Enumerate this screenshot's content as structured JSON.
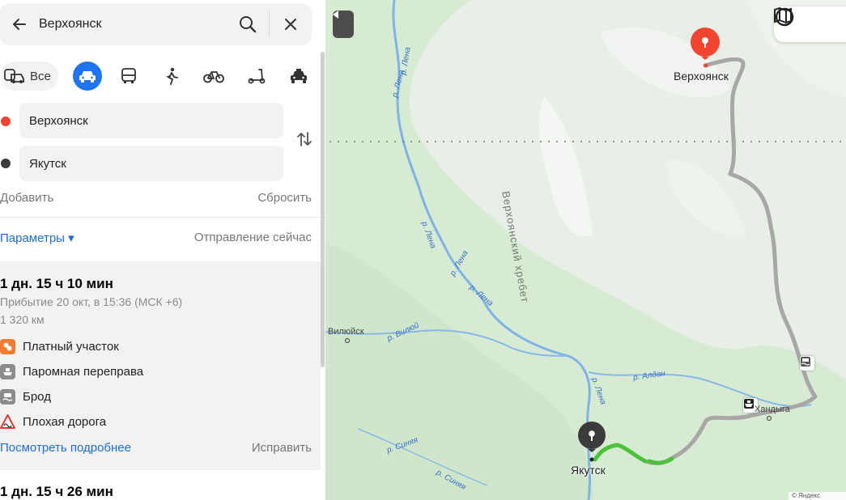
{
  "search": {
    "query": "Верхоянск"
  },
  "modes": {
    "all_label": "Все"
  },
  "route_points": {
    "from": "Верхоянск",
    "to": "Якутск",
    "add_label": "Добавить",
    "reset_label": "Сбросить"
  },
  "params": {
    "label": "Параметры ▾",
    "departure": "Отправление сейчас"
  },
  "routes": [
    {
      "duration": "1 дн. 15 ч 10 мин",
      "arrival": "Прибытие 20 окт, в 15:36 (МСК +6)",
      "distance": "1 320 км",
      "features": [
        {
          "label": "Платный участок",
          "icon": "toll-icon",
          "color": "#f37b33"
        },
        {
          "label": "Паромная переправа",
          "icon": "ferry-icon",
          "color": "#8c8c8c"
        },
        {
          "label": "Брод",
          "icon": "ford-icon",
          "color": "#8c8c8c"
        },
        {
          "label": "Плохая дорога",
          "icon": "bad-road-icon",
          "color": "#e53935"
        }
      ],
      "details_link": "Посмотреть подробнее",
      "fix_link": "Исправить"
    },
    {
      "duration": "1 дн. 15 ч 26 мин"
    }
  ],
  "map": {
    "cities": {
      "start": "Верхоянск",
      "end": "Якутск",
      "vilyuysk": "Вилюйск",
      "handyga": "Хандыга"
    },
    "rivers": {
      "lena_1": "р. Лена",
      "lena_2": "р. Лена",
      "lena_3": "р. Лена",
      "lena_4": "р. Лена",
      "lena_5": "р. Лена",
      "lena_6": "р. Лена",
      "vilyuy": "р. Вилюй",
      "aldan": "р. Алдан",
      "sinyaya_1": "р. Синяя",
      "sinyaya_2": "р. Синяя"
    },
    "range": "Верхоянский хребет",
    "copyright": "© Яндекс"
  },
  "colors": {
    "accent": "#1f74f0",
    "start_pin": "#f2442f",
    "end_pin": "#3b3b3b",
    "route_gray": "#a7a7a7",
    "route_green": "#4cc23a"
  }
}
